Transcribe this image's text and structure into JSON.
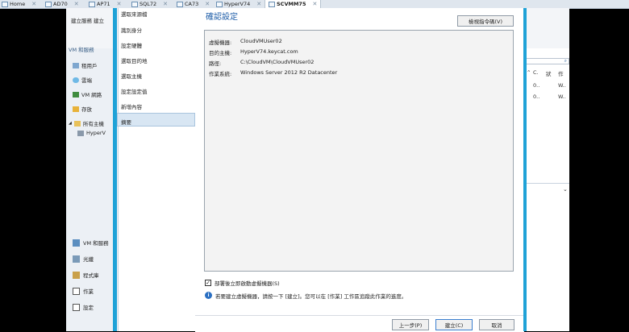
{
  "tabs": [
    {
      "label": "Home"
    },
    {
      "label": "AD70"
    },
    {
      "label": "AP71"
    },
    {
      "label": "SQL72"
    },
    {
      "label": "CA73"
    },
    {
      "label": "HyperV74"
    },
    {
      "label": "SCVMM75",
      "active": true
    }
  ],
  "background": {
    "ribbon": {
      "btn1": "建立服務",
      "btn2": "建立"
    },
    "nav_header": "VM 和服務",
    "nav": [
      "租用戶",
      "雲端",
      "VM 網路",
      "存放",
      "所有主機",
      "HyperV"
    ],
    "workspaces": [
      "VM 和服務",
      "光纖",
      "程式庫",
      "作業",
      "設定"
    ],
    "right": {
      "cols": [
        "C.",
        "狀",
        "作"
      ],
      "rows": [
        [
          "0..",
          "W.."
        ],
        [
          "0..",
          "W.."
        ]
      ]
    }
  },
  "wizard": {
    "steps": [
      "選取來源檔",
      "識別身分",
      "設定硬體",
      "選取目的地",
      "選取主機",
      "設定設定值",
      "新增內容",
      "摘要"
    ],
    "selected_step": "摘要",
    "title": "確認設定",
    "view_script_label": "檢視指令碼(V)",
    "summary": {
      "vm": {
        "key": "虛擬機器:",
        "value": "CloudVMUser02"
      },
      "host": {
        "key": "目的主機:",
        "value": "HyperV74.keycat.com"
      },
      "path": {
        "key": "路徑:",
        "value": "C:\\CloudVM\\CloudVMUser02"
      },
      "os": {
        "key": "作業系統:",
        "value": "Windows Server 2012 R2 Datacenter"
      }
    },
    "start_vm_checkbox": {
      "label": "部署後立即啟動虛擬機器(S)",
      "checked": true
    },
    "info_text": "若要建立虛擬機器，請按一下 [建立]。您可以在 [作業] 工作區追蹤此作業的進度。",
    "buttons": {
      "prev": "上一步(P)",
      "create": "建立(C)",
      "cancel": "取消"
    }
  }
}
